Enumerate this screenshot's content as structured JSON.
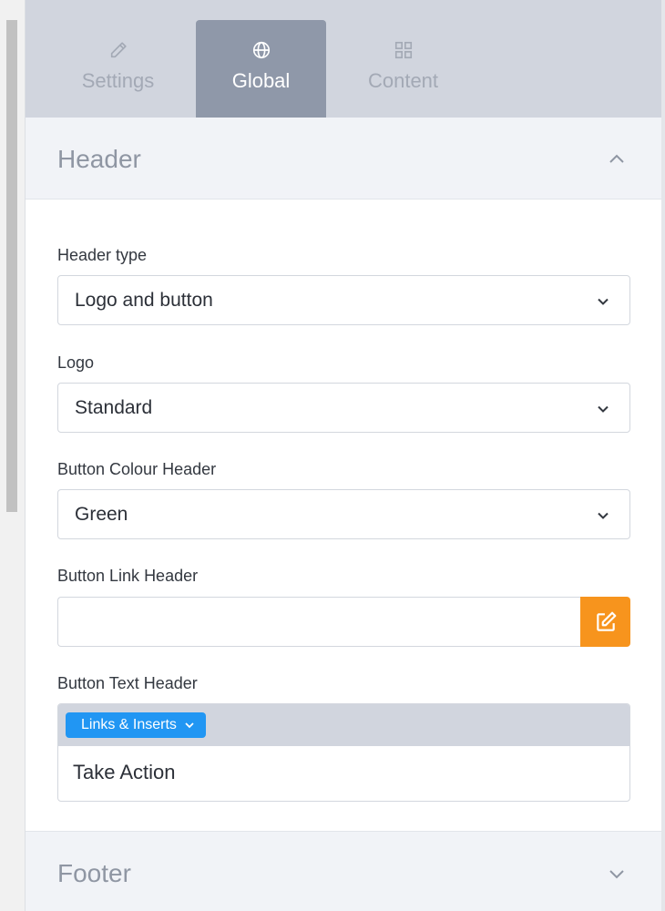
{
  "tabs": [
    {
      "label": "Settings",
      "icon": "pencil-icon",
      "active": false
    },
    {
      "label": "Global",
      "icon": "globe-icon",
      "active": true
    },
    {
      "label": "Content",
      "icon": "grid-icon",
      "active": false
    }
  ],
  "sections": {
    "header": {
      "title": "Header",
      "expanded": true
    },
    "footer": {
      "title": "Footer",
      "expanded": false
    }
  },
  "fields": {
    "header_type": {
      "label": "Header type",
      "value": "Logo and button"
    },
    "logo": {
      "label": "Logo",
      "value": "Standard"
    },
    "button_colour": {
      "label": "Button Colour Header",
      "value": "Green"
    },
    "button_link": {
      "label": "Button Link Header",
      "value": ""
    },
    "button_text": {
      "label": "Button Text Header",
      "toolbar_button": "Links & Inserts",
      "value": "Take Action"
    }
  },
  "colors": {
    "active_tab": "#8f98a9",
    "edit_button": "#f7941d",
    "links_button": "#2196f3"
  }
}
